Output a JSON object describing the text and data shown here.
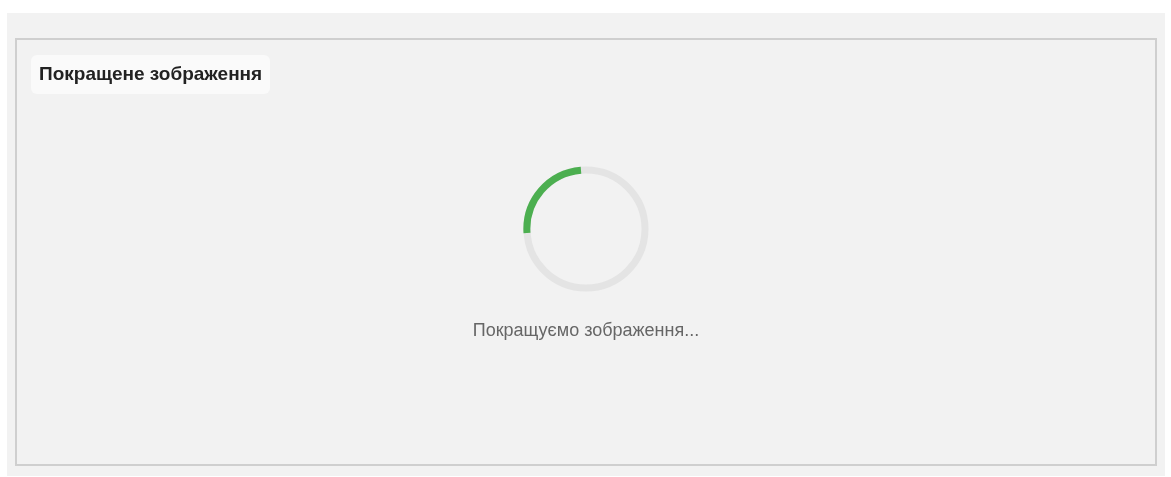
{
  "panel": {
    "title": "Покращене зображення"
  },
  "loader": {
    "message": "Покращуємо зображення..."
  }
}
